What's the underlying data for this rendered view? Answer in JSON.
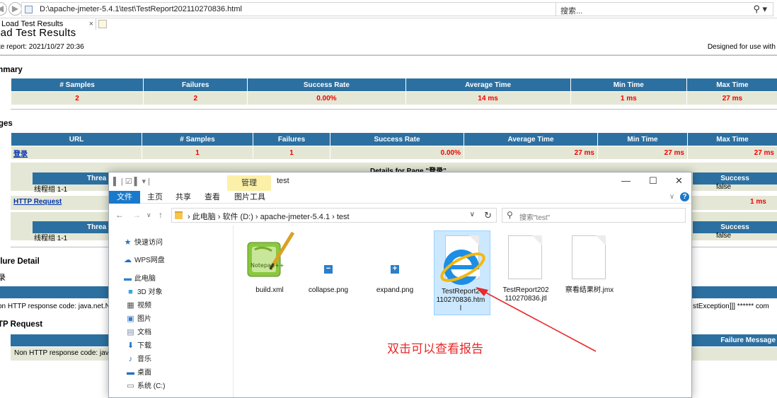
{
  "browser": {
    "back_icon": "back-icon",
    "forward_icon": "forward-icon",
    "back_glyph": "◀",
    "forward_glyph": "▶",
    "address": "D:\\apache-jmeter-5.4.1\\test\\TestReport202110270836.html",
    "address_tools": "▾ Ċ",
    "search_placeholder": "搜索...",
    "search_glyph": "⚲ ▾",
    "tab_title": "Load Test Results",
    "tab_close": "×"
  },
  "report": {
    "title": "oad Test Results",
    "date": "te report: 2021/10/27 20:36",
    "designed": "Designed for use with",
    "summary_heading": "mmary",
    "summary": {
      "headers": [
        "# Samples",
        "Failures",
        "Success Rate",
        "Average Time",
        "Min Time",
        "Max Time"
      ],
      "values": [
        "2",
        "2",
        "0.00%",
        "14 ms",
        "1 ms",
        "27 ms"
      ]
    },
    "pages_heading": "ges",
    "pages": {
      "headers": [
        "URL",
        "# Samples",
        "Failures",
        "Success Rate",
        "Average Time",
        "Min Time",
        "Max Time"
      ],
      "row1": [
        "登录",
        "1",
        "1",
        "0.00%",
        "27 ms",
        "27 ms",
        "27 ms"
      ]
    },
    "details_for_page": "Details for Page \"登录\"",
    "detail_thread_header": "Threa",
    "detail_success_header": "Success",
    "detail_thread_value": "线程组 1-1",
    "detail_success_value": "false",
    "http_request_link": "HTTP Request",
    "http_min_time": "1 ms",
    "failure_detail_heading": "ilure Detail",
    "failure_page1": "录",
    "failure_line_left": "on HTTP response code: java.net.No",
    "failure_line_right": "stException]]] ****** com",
    "http_request_heading": "TP Request",
    "failure_message_header": "Failure Message",
    "failure_line2_left": "Non HTTP response code: java"
  },
  "explorer": {
    "quick_access": "▌ | ☑ ▌ ▾ |",
    "context_tab": "管理",
    "title": "test",
    "minimize": "—",
    "maximize": "☐",
    "close": "✕",
    "ribbon": {
      "file": "文件",
      "home": "主页",
      "share": "共享",
      "view": "查看",
      "picture_tools": "图片工具",
      "expand": "∨",
      "help": "?"
    },
    "nav_arrows": [
      "←",
      "→",
      "∨",
      "↑"
    ],
    "breadcrumb": "›  此电脑  ›  软件 (D:)  ›  apache-jmeter-5.4.1  ›  test",
    "breadcrumb_dropdown": "∨",
    "refresh": "↻",
    "search_glyph": "⚲",
    "search_placeholder": "搜索\"test\"",
    "nav_items": [
      {
        "label": "快速访问",
        "icon": "star-icon",
        "glyph": "★",
        "color": "#1f6fc5"
      },
      {
        "label": "WPS网盘",
        "icon": "cloud-icon",
        "glyph": "☁",
        "color": "#1f6fc5"
      },
      {
        "label": "此电脑",
        "icon": "computer-icon",
        "glyph": "▬",
        "color": "#2f83cc"
      },
      {
        "label": "3D 对象",
        "icon": "cube-icon",
        "glyph": "■",
        "color": "#34a6e6"
      },
      {
        "label": "视频",
        "icon": "video-icon",
        "glyph": "▦",
        "color": "#555555"
      },
      {
        "label": "图片",
        "icon": "picture-icon",
        "glyph": "▣",
        "color": "#3a7bc8"
      },
      {
        "label": "文档",
        "icon": "document-icon",
        "glyph": "▤",
        "color": "#7b8da6"
      },
      {
        "label": "下载",
        "icon": "download-icon",
        "glyph": "⬇",
        "color": "#1f6fc5"
      },
      {
        "label": "音乐",
        "icon": "music-icon",
        "glyph": "♪",
        "color": "#1f6fc5"
      },
      {
        "label": "桌面",
        "icon": "desktop-icon",
        "glyph": "▬",
        "color": "#1f6fc5"
      },
      {
        "label": "系统 (C:)",
        "icon": "drive-icon",
        "glyph": "▭",
        "color": "#6a6a6a"
      }
    ],
    "files": [
      {
        "name": "build.xml",
        "icon": "notepad-plus-plus-icon",
        "logo_text": "Notepad++"
      },
      {
        "name": "collapse.png",
        "icon": "collapse-icon",
        "glyph": "−"
      },
      {
        "name": "expand.png",
        "icon": "expand-icon",
        "glyph": "+"
      },
      {
        "name": "TestReport202110270836.html",
        "icon": "internet-explorer-icon",
        "line1": "TestReport2",
        "line2": "110270836.htm",
        "line3": "l"
      },
      {
        "name": "TestReport202110270836.jtl",
        "icon": "blank-file-icon",
        "line1": "TestReport202",
        "line2": "110270836.jtl"
      },
      {
        "name": "察看结果树.jmx",
        "icon": "blank-file-icon"
      }
    ]
  },
  "annotation": {
    "text": "双击可以查看报告",
    "color": "#e72a2a"
  },
  "colors": {
    "header_blue": "#2c70a1",
    "cell_beige": "#e4e7d5",
    "value_red": "#f00000",
    "ribbon_blue": "#1979ca",
    "context_yellow": "#fcf0a8"
  }
}
